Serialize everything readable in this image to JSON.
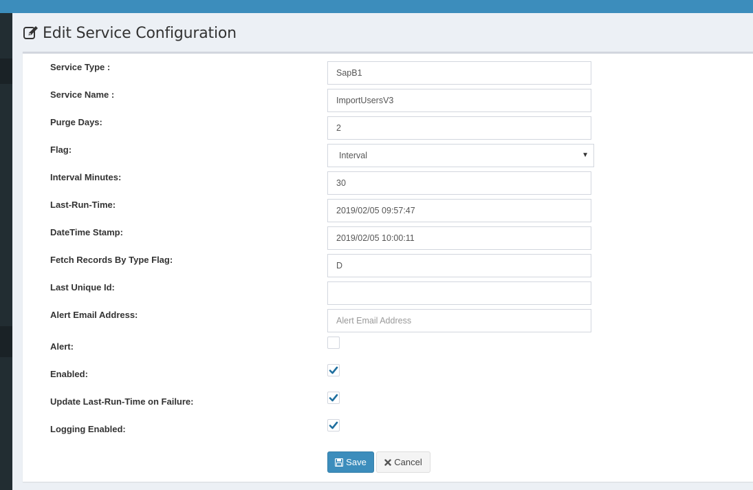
{
  "page": {
    "title": "Edit Service Configuration",
    "title_icon": "edit-icon"
  },
  "form": {
    "fields": [
      {
        "label": "Service Type :",
        "value": "SapB1"
      },
      {
        "label": "Service Name :",
        "value": "ImportUsersV3"
      },
      {
        "label": "Purge Days:",
        "value": "2"
      },
      {
        "label": "Flag:",
        "value": "Interval"
      },
      {
        "label": "Interval Minutes:",
        "value": "30"
      },
      {
        "label": "Last-Run-Time:",
        "value": "2019/02/05 09:57:47"
      },
      {
        "label": "DateTime Stamp:",
        "value": "2019/02/05 10:00:11"
      },
      {
        "label": "Fetch Records By Type Flag:",
        "value": "D"
      },
      {
        "label": "Last Unique Id:",
        "value": ""
      },
      {
        "label": "Alert Email Address:",
        "value": "",
        "placeholder": "Alert Email Address"
      }
    ],
    "checkboxes": [
      {
        "label": "Alert:",
        "checked": false
      },
      {
        "label": "Enabled:",
        "checked": true
      },
      {
        "label": "Update Last-Run-Time on Failure:",
        "checked": true
      },
      {
        "label": "Logging Enabled:",
        "checked": true
      }
    ]
  },
  "buttons": {
    "save_label": "Save",
    "save_icon": "floppy-disk-icon",
    "cancel_label": "Cancel",
    "cancel_icon": "close-icon"
  },
  "colors": {
    "topbar": "#3c8dbc",
    "sidebar": "#222d32",
    "primary": "#3c8dbc",
    "checkmark": "#1f6f9f",
    "background": "#ecf0f5"
  }
}
